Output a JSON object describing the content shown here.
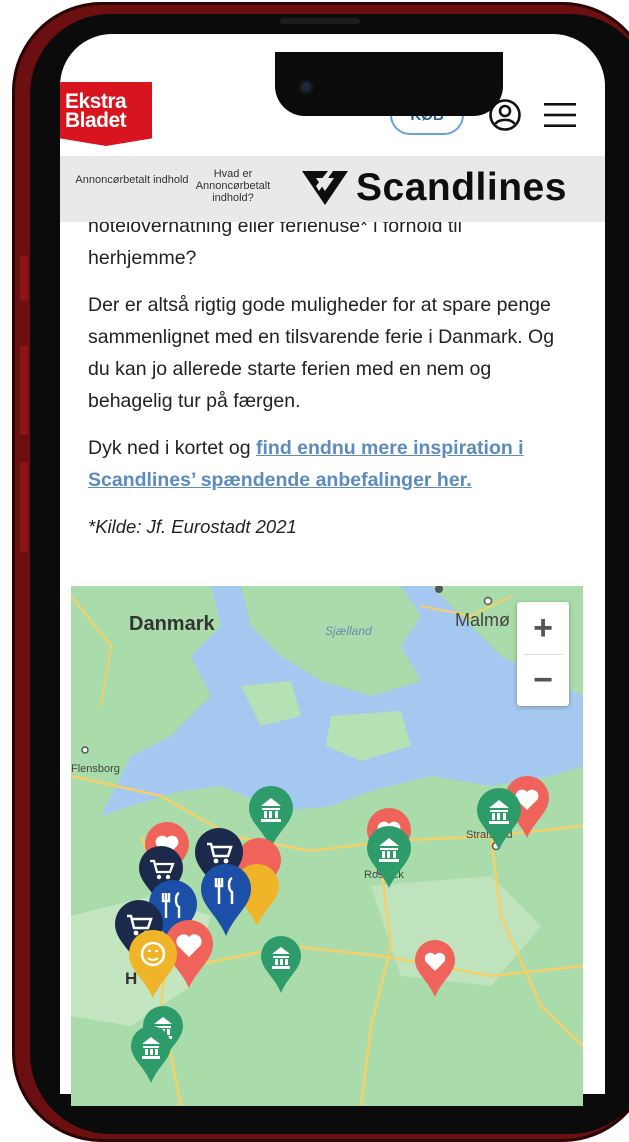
{
  "header": {
    "logo_line1": "Ekstra",
    "logo_line2": "Bladet",
    "buy_label": "KØB",
    "user_icon": "user-circle-icon",
    "menu_icon": "hamburger-menu-icon"
  },
  "sponsor": {
    "label_left": "Annoncørbetalt indhold",
    "label_info": "Hvad er Annoncørbetalt indhold?",
    "brand": "Scandlines"
  },
  "article": {
    "partial_line": "hotelovernatning eller feriehuse* i forhold til",
    "line2": "herhjemme?",
    "paragraph2": "Der er altså rigtig gode muligheder for at spare penge sammenlignet med en tilsvarende ferie i Danmark. Og du kan jo allerede starte ferien med en nem og behagelig tur på færgen.",
    "p3_text": "Dyk ned i kortet og ",
    "p3_link": "find endnu mere inspiration i Scandlines’ spændende anbefalinger her.",
    "source": "*Kilde: Jf. Eurostadt 2021"
  },
  "map": {
    "labels": [
      "Danmark",
      "Sjælland",
      "Malmø",
      "Flensborg",
      "Stralsund",
      "Rostock",
      "H"
    ],
    "zoom_in": "+",
    "zoom_out": "−",
    "pin_colors": {
      "museum": "#2e9b6b",
      "heart": "#f0635a",
      "shopping": "#1b2a4a",
      "restaurant": "#1c4fa8",
      "theatre": "#f0b429"
    }
  },
  "colors": {
    "brand_red": "#d8141e",
    "link_blue": "#5b8bbf",
    "button_border": "#6aa2d6",
    "map_water": "#a5c8f0",
    "map_land": "#a9dcaa"
  }
}
